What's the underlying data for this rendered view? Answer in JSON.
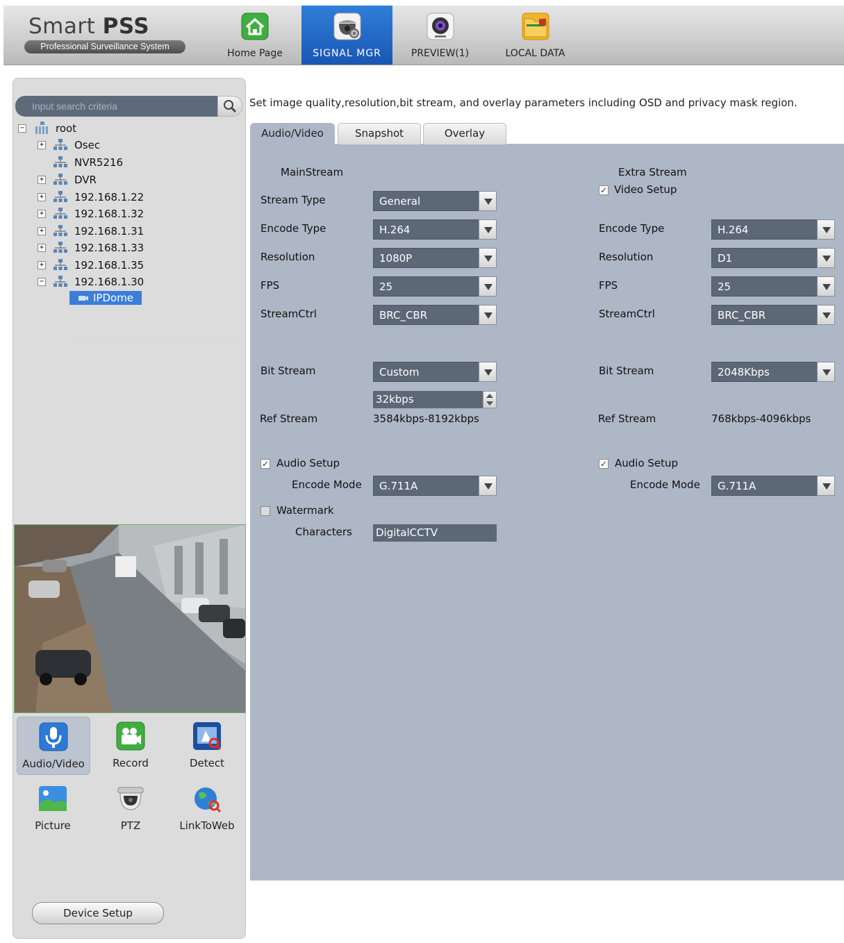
{
  "app": {
    "title_light": "Smart ",
    "title_bold": "PSS",
    "subtitle": "Professional Surveillance System"
  },
  "nav": {
    "tabs": [
      {
        "label": "Home Page",
        "icon": "home-icon"
      },
      {
        "label": "SIGNAL MGR",
        "icon": "camera-dome-gear-icon",
        "active": true
      },
      {
        "label": "PREVIEW(1)",
        "icon": "webcam-icon"
      },
      {
        "label": "LOCAL DATA",
        "icon": "folder-icon"
      }
    ]
  },
  "search": {
    "placeholder": "Input search criteria"
  },
  "tree": {
    "root": "root",
    "nodes": [
      "Osec",
      "NVR5216",
      "DVR",
      "192.168.1.22",
      "192.168.1.32",
      "192.168.1.31",
      "192.168.1.33",
      "192.168.1.35",
      "192.168.1.30"
    ],
    "selected": "IPDome"
  },
  "functions": {
    "items": [
      "Audio/Video",
      "Record",
      "Detect",
      "Picture",
      "PTZ",
      "LinkToWeb"
    ],
    "active": "Audio/Video"
  },
  "device_setup": "Device Setup",
  "description": "Set image quality,resolution,bit stream, and overlay parameters including OSD and privacy mask region.",
  "config_tabs": [
    "Audio/Video",
    "Snapshot",
    "Overlay"
  ],
  "main_stream": {
    "heading": "MainStream",
    "stream_type_label": "Stream Type",
    "stream_type": "General",
    "encode_type_label": "Encode Type",
    "encode_type": "H.264",
    "resolution_label": "Resolution",
    "resolution": "1080P",
    "fps_label": "FPS",
    "fps": "25",
    "streamctrl_label": "StreamCtrl",
    "streamctrl": "BRC_CBR",
    "bitstream_label": "Bit Stream",
    "bitstream": "Custom",
    "bitstream_custom": "32kbps",
    "ref_stream_label": "Ref Stream",
    "ref_stream": "3584kbps-8192kbps",
    "audio_setup_label": "Audio Setup",
    "audio_setup_checked": true,
    "encode_mode_label": "Encode Mode",
    "encode_mode": "G.711A",
    "watermark_label": "Watermark",
    "watermark_checked": false,
    "characters_label": "Characters",
    "characters": "DigitalCCTV"
  },
  "extra_stream": {
    "heading": "Extra Stream",
    "video_setup_label": "Video Setup",
    "video_setup_checked": true,
    "encode_type_label": "Encode Type",
    "encode_type": "H.264",
    "resolution_label": "Resolution",
    "resolution": "D1",
    "fps_label": "FPS",
    "fps": "25",
    "streamctrl_label": "StreamCtrl",
    "streamctrl": "BRC_CBR",
    "bitstream_label": "Bit Stream",
    "bitstream": "2048Kbps",
    "ref_stream_label": "Ref Stream",
    "ref_stream": "768kbps-4096kbps",
    "audio_setup_label": "Audio Setup",
    "audio_setup_checked": true,
    "encode_mode_label": "Encode Mode",
    "encode_mode": "G.711A"
  },
  "colors": {
    "accent": "#1f63c4",
    "panel": "#aeb7c6",
    "select_bg": "#5d6877"
  }
}
